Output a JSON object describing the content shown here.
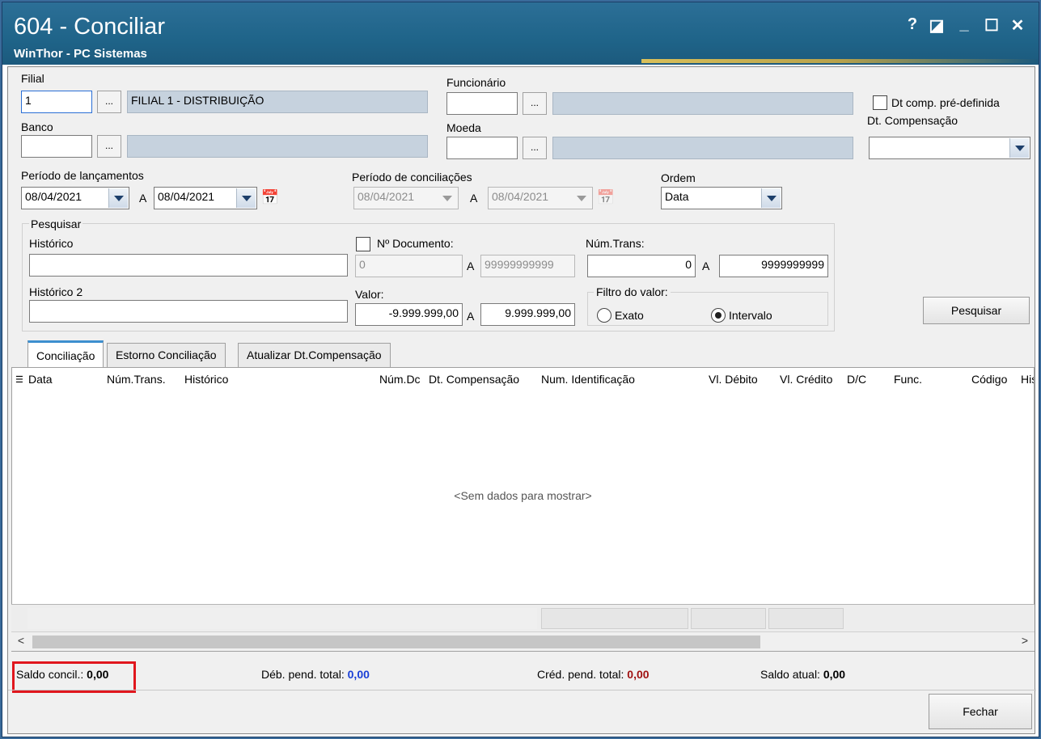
{
  "window": {
    "title": "604 - Conciliar",
    "subtitle": "WinThor - PC Sistemas",
    "buttons": {
      "help": "?",
      "edit": "◪",
      "minimize": "_",
      "maximize": "☐",
      "close": "✕"
    }
  },
  "filters": {
    "filial_label": "Filial",
    "filial_code": "1",
    "filial_name": "FILIAL 1 - DISTRIBUIÇÃO",
    "banco_label": "Banco",
    "banco_code": "",
    "banco_name": "",
    "funcionario_label": "Funcionário",
    "funcionario_code": "",
    "funcionario_name": "",
    "moeda_label": "Moeda",
    "moeda_code": "",
    "moeda_name": "",
    "dots_label": "...",
    "dt_comp_predef_label": "Dt comp. pré-definida",
    "dt_compensacao_label": "Dt. Compensação",
    "dt_compensacao_value": "",
    "periodo_lanc_label": "Período de lançamentos",
    "periodo_lanc_from": "08/04/2021",
    "periodo_lanc_to": "08/04/2021",
    "a_label": "A",
    "periodo_conc_label": "Período de conciliações",
    "periodo_conc_from": "08/04/2021",
    "periodo_conc_to": "08/04/2021",
    "ordem_label": "Ordem",
    "ordem_value": "Data"
  },
  "search": {
    "group_label": "Pesquisar",
    "historico_label": "Histórico",
    "historico_value": "",
    "historico2_label": "Histórico 2",
    "historico2_value": "",
    "ndoc_label": "Nº Documento:",
    "ndoc_from": "0",
    "ndoc_to": "99999999999",
    "numtrans_label": "Núm.Trans:",
    "numtrans_from": "0",
    "numtrans_to": "9999999999",
    "valor_label": "Valor:",
    "valor_from": "-9.999.999,00",
    "valor_to": "9.999.999,00",
    "filtro_label": "Filtro do valor:",
    "exato_label": "Exato",
    "intervalo_label": "Intervalo",
    "pesquisar_button": "Pesquisar"
  },
  "tabs": [
    {
      "label": "Conciliação"
    },
    {
      "label": "Estorno Conciliação"
    },
    {
      "label": "Atualizar Dt.Compensação"
    }
  ],
  "grid": {
    "columns": [
      "Data",
      "Núm.Trans.",
      "Histórico",
      "Núm.Dc",
      "Dt. Compensação",
      "Num. Identificação",
      "Vl. Débito",
      "Vl. Crédito",
      "D/C",
      "Func.",
      "Código",
      "His"
    ],
    "empty_text": "<Sem dados para mostrar>"
  },
  "summary": {
    "saldo_concil_label": "Saldo concil.:",
    "saldo_concil_value": "0,00",
    "deb_pend_label": "Déb. pend. total:",
    "deb_pend_value": "0,00",
    "cred_pend_label": "Créd. pend. total:",
    "cred_pend_value": "0,00",
    "saldo_atual_label": "Saldo atual:",
    "saldo_atual_value": "0,00"
  },
  "fechar_button": "Fechar",
  "colors": {
    "title_bar": "#1f6489",
    "debit": "#1a3fd6",
    "credit": "#a01212",
    "highlight": "#e0161d"
  }
}
